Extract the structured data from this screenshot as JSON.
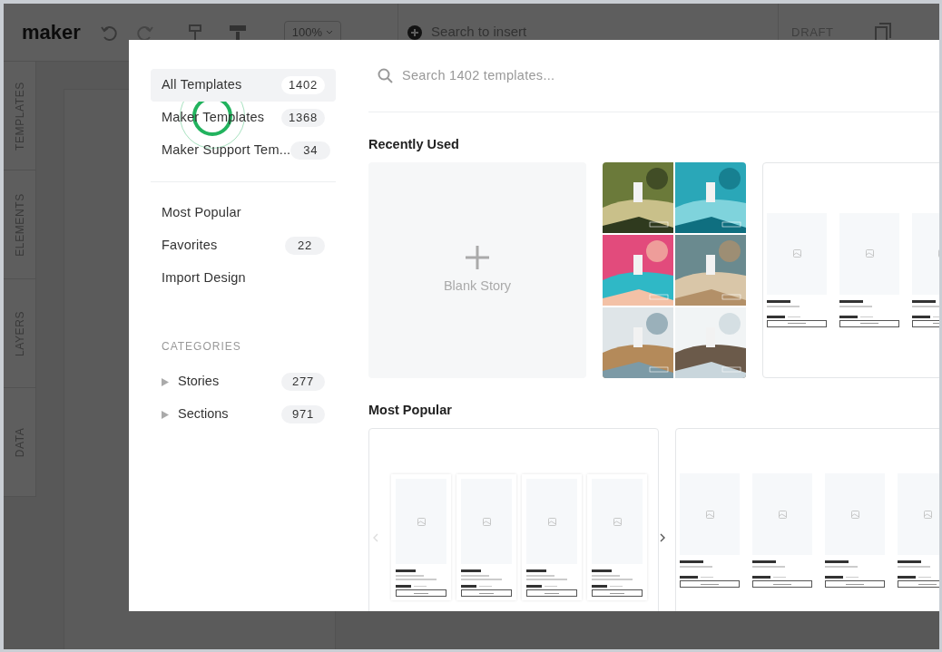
{
  "app": {
    "logo": "maker",
    "zoom": "100%",
    "insert_placeholder": "Search to insert",
    "status": "DRAFT",
    "side_tabs": [
      "TEMPLATES",
      "ELEMENTS",
      "LAYERS",
      "DATA"
    ]
  },
  "modal": {
    "nav": [
      {
        "label": "All Templates",
        "count": "1402",
        "selected": true
      },
      {
        "label": "Maker Templates",
        "count": "1368",
        "selected": false
      },
      {
        "label": "Maker Support Tem...",
        "count": "34",
        "selected": false
      }
    ],
    "links": [
      {
        "label": "Most Popular"
      },
      {
        "label": "Favorites",
        "count": "22"
      },
      {
        "label": "Import Design"
      }
    ],
    "categories_heading": "CATEGORIES",
    "categories": [
      {
        "label": "Stories",
        "count": "277",
        "expanded": false
      },
      {
        "label": "Sections",
        "count": "971",
        "expanded": false
      }
    ],
    "search_placeholder": "Search 1402 templates...",
    "sections": [
      {
        "title": "Recently Used",
        "cards": [
          {
            "kind": "blank",
            "label": "Blank Story"
          },
          {
            "kind": "photo_grid"
          },
          {
            "kind": "product_row"
          }
        ]
      },
      {
        "title": "Most Popular",
        "cards": [
          {
            "kind": "carousel"
          },
          {
            "kind": "product_row"
          }
        ]
      }
    ]
  }
}
